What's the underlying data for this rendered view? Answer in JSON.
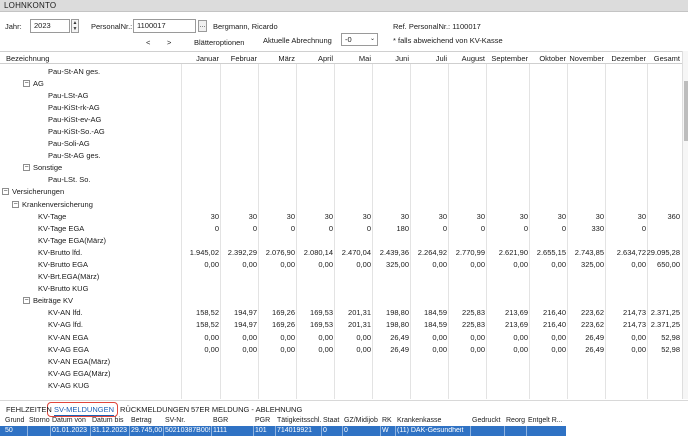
{
  "window": {
    "title": "LOHNKONTO"
  },
  "header": {
    "jahr_label": "Jahr:",
    "jahr_value": "2023",
    "personal_label": "PersonalNr.:",
    "personal_value": "1100017",
    "browse_label": "...",
    "name": "Bergmann, Ricardo",
    "ref_label": "Ref. PersonalNr.: 1100017",
    "prev_label": "<",
    "next_label": ">",
    "blaetter_label": "Blätteroptionen",
    "abrechnung_label": "Aktuelle Abrechnung",
    "abrechnung_value": "-0",
    "kv_note": "* falls abweichend von KV-Kasse"
  },
  "columns": [
    "Bezeichnung",
    "Januar",
    "Februar",
    "März",
    "April",
    "Mai",
    "Juni",
    "Juli",
    "August",
    "September",
    "Oktober",
    "November",
    "Dezember",
    "Gesamt"
  ],
  "rows": [
    {
      "label": "Pau-St-AN ges.",
      "level": 4,
      "toggle": "",
      "values": []
    },
    {
      "label": "AG",
      "level": 2,
      "toggle": "−",
      "values": []
    },
    {
      "label": "Pau-LSt-AG",
      "level": 4,
      "toggle": "",
      "values": []
    },
    {
      "label": "Pau-KiSt-rk-AG",
      "level": 4,
      "toggle": "",
      "values": []
    },
    {
      "label": "Pau-KiSt-ev-AG",
      "level": 4,
      "toggle": "",
      "values": []
    },
    {
      "label": "Pau-KiSt-So.-AG",
      "level": 4,
      "toggle": "",
      "values": []
    },
    {
      "label": "Pau-Soli-AG",
      "level": 4,
      "toggle": "",
      "values": []
    },
    {
      "label": "Pau-St-AG ges.",
      "level": 4,
      "toggle": "",
      "values": []
    },
    {
      "label": "Sonstige",
      "level": 2,
      "toggle": "−",
      "values": []
    },
    {
      "label": "Pau-LSt. So.",
      "level": 4,
      "toggle": "",
      "values": []
    },
    {
      "label": "Versicherungen",
      "level": 0,
      "toggle": "−",
      "values": []
    },
    {
      "label": "Krankenversicherung",
      "level": 1,
      "toggle": "−",
      "values": []
    },
    {
      "label": "KV-Tage",
      "level": 3,
      "toggle": "",
      "values": [
        "30",
        "30",
        "30",
        "30",
        "30",
        "30",
        "30",
        "30",
        "30",
        "30",
        "30",
        "30",
        "360"
      ]
    },
    {
      "label": "KV-Tage EGA",
      "level": 3,
      "toggle": "",
      "values": [
        "0",
        "0",
        "0",
        "0",
        "0",
        "180",
        "0",
        "0",
        "0",
        "0",
        "330",
        "0",
        ""
      ]
    },
    {
      "label": "KV-Tage EGA(März)",
      "level": 3,
      "toggle": "",
      "values": []
    },
    {
      "label": "KV-Brutto lfd.",
      "level": 3,
      "toggle": "",
      "values": [
        "1.945,02",
        "2.392,29",
        "2.076,90",
        "2.080,14",
        "2.470,04",
        "2.439,36",
        "2.264,92",
        "2.770,99",
        "2.621,90",
        "2.655,15",
        "2.743,85",
        "2.634,72",
        "29.095,28"
      ]
    },
    {
      "label": "KV-Brutto EGA",
      "level": 3,
      "toggle": "",
      "values": [
        "0,00",
        "0,00",
        "0,00",
        "0,00",
        "0,00",
        "325,00",
        "0,00",
        "0,00",
        "0,00",
        "0,00",
        "325,00",
        "0,00",
        "650,00"
      ]
    },
    {
      "label": "KV-Brt.EGA(März)",
      "level": 3,
      "toggle": "",
      "values": []
    },
    {
      "label": "KV-Brutto KUG",
      "level": 3,
      "toggle": "",
      "values": []
    },
    {
      "label": "Beiträge KV",
      "level": 2,
      "toggle": "−",
      "values": []
    },
    {
      "label": "KV-AN lfd.",
      "level": 4,
      "toggle": "",
      "values": [
        "158,52",
        "194,97",
        "169,26",
        "169,53",
        "201,31",
        "198,80",
        "184,59",
        "225,83",
        "213,69",
        "216,40",
        "223,62",
        "214,73",
        "2.371,25"
      ]
    },
    {
      "label": "KV-AG lfd.",
      "level": 4,
      "toggle": "",
      "values": [
        "158,52",
        "194,97",
        "169,26",
        "169,53",
        "201,31",
        "198,80",
        "184,59",
        "225,83",
        "213,69",
        "216,40",
        "223,62",
        "214,73",
        "2.371,25"
      ]
    },
    {
      "label": "KV-AN EGA",
      "level": 4,
      "toggle": "",
      "values": [
        "0,00",
        "0,00",
        "0,00",
        "0,00",
        "0,00",
        "26,49",
        "0,00",
        "0,00",
        "0,00",
        "0,00",
        "26,49",
        "0,00",
        "52,98"
      ]
    },
    {
      "label": "KV-AG EGA",
      "level": 4,
      "toggle": "",
      "values": [
        "0,00",
        "0,00",
        "0,00",
        "0,00",
        "0,00",
        "26,49",
        "0,00",
        "0,00",
        "0,00",
        "0,00",
        "26,49",
        "0,00",
        "52,98"
      ]
    },
    {
      "label": "KV-AN EGA(März)",
      "level": 4,
      "toggle": "",
      "values": []
    },
    {
      "label": "KV-AG EGA(März)",
      "level": 4,
      "toggle": "",
      "values": []
    },
    {
      "label": "KV-AG KUG",
      "level": 4,
      "toggle": "",
      "values": []
    }
  ],
  "tabs": [
    {
      "label": "FEHLZEITEN",
      "active": false
    },
    {
      "label": "SV-MELDUNGEN",
      "active": true
    },
    {
      "label": "RÜCKMELDUNGEN",
      "active": false
    },
    {
      "label": "57ER MELDUNG - ABLEHNUNG",
      "active": false
    }
  ],
  "bottom_grid": {
    "headers": [
      "Grund",
      "Storno",
      "Datum von",
      "Datum bis",
      "Betrag",
      "SV-Nr.",
      "BGR",
      "PGR",
      "Tätigkeitsschl.",
      "Staat",
      "GZ/Midijob",
      "RK",
      "Krankenkasse",
      "Gedruckt",
      "Reorg",
      "Entgelt R..."
    ],
    "row": [
      "50",
      "",
      "01.01.2023",
      "31.12.2023",
      "29.745,00",
      "50210387B009",
      "1111",
      "101",
      "714019921",
      "0",
      "0",
      "W",
      "(11) DAK-Gesundheit",
      "",
      "",
      ""
    ]
  }
}
